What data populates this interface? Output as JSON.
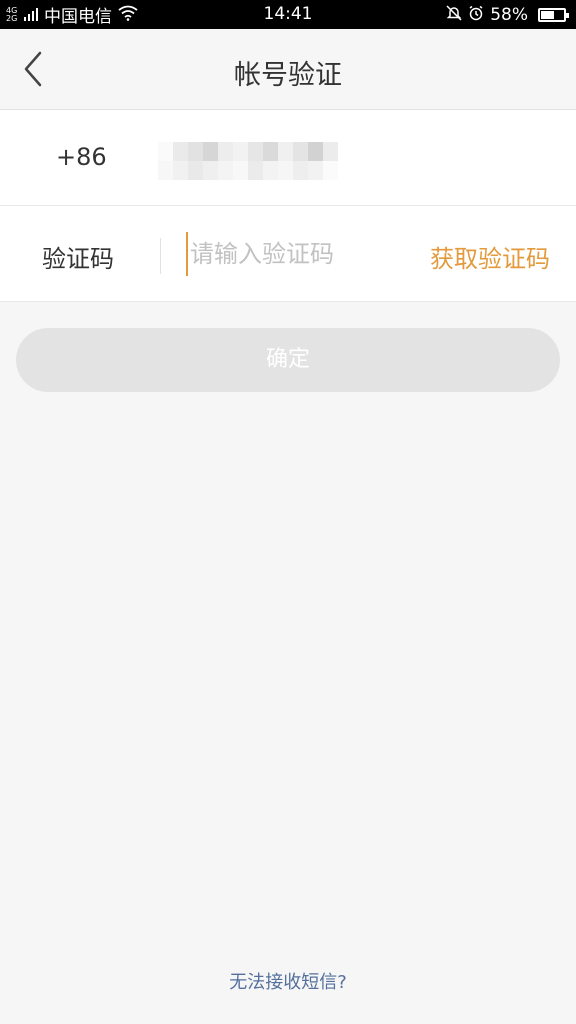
{
  "status_bar": {
    "network": "4G 2G",
    "carrier": "中国电信",
    "time": "14:41",
    "battery": "58%",
    "battery_level": 0.58
  },
  "nav": {
    "title": "帐号验证"
  },
  "form": {
    "country_code": "+86",
    "code_label": "验证码",
    "code_placeholder": "请输入验证码",
    "get_code_label": "获取验证码"
  },
  "actions": {
    "confirm_label": "确定",
    "no_sms_label": "无法接收短信?"
  },
  "colors": {
    "accent": "#e39a3c",
    "link": "#54709c",
    "button_disabled": "#e3e3e3"
  }
}
